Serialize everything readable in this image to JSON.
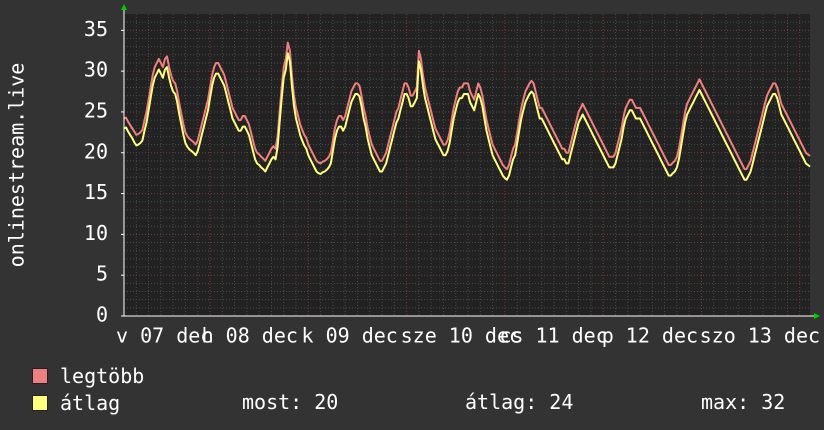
{
  "chart_data": {
    "type": "line",
    "ylabel": "onlinestream.live",
    "ylim": [
      0,
      37
    ],
    "yticks": [
      "0",
      "5",
      "10",
      "15",
      "20",
      "25",
      "30",
      "35"
    ],
    "xtick_labels": [
      "v 07 dec",
      "h 08 dec",
      "k 09 dec",
      "sze 10 dec",
      "cs 11 dec",
      "p 12 dec",
      "szo 13 dec"
    ],
    "grid": true,
    "colors": {
      "background": "#333333",
      "plot_bg": "#222222",
      "grid_major": "#7a3a3a",
      "grid_minor": "#4a4a4a",
      "max_series": "#f08080",
      "avg_series": "#ffff80",
      "axis_arrow": "#00cc00"
    },
    "x": [
      0,
      0.5,
      1,
      1.5,
      2,
      2.5,
      3,
      3.5,
      4,
      4.5,
      5,
      5.5,
      6,
      6.5,
      7,
      7.5,
      8,
      8.5,
      9,
      9.5,
      10,
      10.5,
      11,
      11.5,
      12,
      12.5,
      13,
      13.5,
      14,
      14.5,
      15,
      15.5,
      16,
      16.5,
      17,
      17.5,
      18,
      18.5,
      19,
      19.5,
      20,
      20.5,
      21,
      21.5,
      22,
      22.5,
      23,
      23.5,
      24,
      24.5,
      25,
      25.5,
      26,
      26.5,
      27,
      27.5,
      28,
      28.5,
      29,
      29.5,
      30,
      30.5,
      31,
      31.5,
      32,
      32.5,
      33,
      33.5,
      34,
      34.5,
      35,
      35.5,
      36,
      36.5,
      37,
      37.5,
      38,
      38.5,
      39,
      39.5,
      40,
      40.5,
      41,
      41.5,
      42,
      42.5,
      43,
      43.5,
      44,
      44.5,
      45,
      45.5,
      46,
      46.5,
      47,
      47.5,
      48,
      48.5,
      49,
      49.5,
      50,
      50.5,
      51,
      51.5,
      52,
      52.5,
      53,
      53.5,
      54,
      54.5,
      55,
      55.5,
      56,
      56.5,
      57,
      57.5,
      58,
      58.5,
      59,
      59.5,
      60,
      60.5,
      61,
      61.5,
      62,
      62.5,
      63,
      63.5,
      64,
      64.5,
      65,
      65.5,
      66,
      66.5,
      67,
      67.5,
      68,
      68.5,
      69,
      69.5,
      70,
      70.5,
      71,
      71.5,
      72,
      72.5,
      73,
      73.5,
      74,
      74.5,
      75,
      75.5,
      76,
      76.5,
      77,
      77.5,
      78,
      78.5,
      79,
      79.5,
      80,
      80.5,
      81,
      81.5,
      82,
      82.5,
      83,
      83.5,
      84,
      84.5,
      85,
      85.5,
      86,
      86.5,
      87,
      87.5,
      88,
      88.5,
      89,
      89.5,
      90,
      90.5,
      91,
      91.5,
      92,
      92.5,
      93,
      93.5,
      94,
      94.5,
      95,
      95.5,
      96,
      96.5,
      97,
      97.5,
      98,
      98.5,
      99,
      99.5,
      100,
      100.5,
      101,
      101.5,
      102,
      102.5,
      103,
      103.5,
      104,
      104.5,
      105,
      105.5,
      106,
      106.5,
      107,
      107.5,
      108,
      108.5,
      109,
      109.5,
      110,
      110.5,
      111,
      111.5,
      112,
      112.5,
      113,
      113.5,
      114,
      114.5,
      115,
      115.5,
      116,
      116.5,
      117,
      117.5,
      118,
      118.5,
      119,
      119.5,
      120,
      120.5,
      121,
      121.5,
      122,
      122.5,
      123,
      123.5,
      124,
      124.5,
      125,
      125.5,
      126,
      126.5,
      127,
      127.5,
      128,
      128.5,
      129,
      129.5,
      130,
      130.5,
      131,
      131.5,
      132,
      132.5,
      133,
      133.5,
      134,
      134.5,
      135,
      135.5,
      136,
      136.5,
      137,
      137.5,
      138,
      138.5,
      139,
      139.5,
      140,
      140.5,
      141,
      141.5,
      142,
      142.5,
      143,
      143.5,
      144,
      144.5,
      145,
      145.5,
      146,
      146.5,
      147,
      147.5,
      148,
      148.5,
      149,
      149.5,
      150,
      150.5,
      151,
      151.5,
      152,
      152.5,
      153,
      153.5,
      154,
      154.5,
      155,
      155.5,
      156,
      156.5,
      157,
      157.5,
      158,
      158.5,
      159,
      159.5,
      160,
      160.5,
      161,
      161.5,
      162,
      162.5,
      163,
      163.5,
      164,
      164.5,
      165,
      165.5,
      166,
      166.5,
      167,
      167.5
    ],
    "series": [
      {
        "name": "legtöbb",
        "values": [
          24.2,
          24.3,
          23.8,
          23.4,
          23.0,
          22.6,
          22.2,
          22.3,
          22.5,
          22.8,
          24.0,
          25.0,
          26.5,
          28.0,
          29.5,
          30.5,
          31.0,
          31.5,
          31.0,
          30.5,
          31.5,
          31.8,
          30.5,
          29.5,
          28.8,
          28.5,
          27.5,
          26.0,
          24.8,
          23.5,
          22.5,
          22.0,
          21.7,
          21.5,
          21.3,
          21.0,
          21.5,
          22.5,
          23.5,
          24.5,
          25.5,
          26.5,
          28.0,
          29.5,
          30.5,
          31.0,
          31.0,
          30.5,
          30.0,
          29.5,
          28.5,
          27.5,
          26.5,
          25.5,
          25.0,
          24.5,
          24.0,
          24.0,
          24.5,
          24.5,
          24.0,
          23.5,
          22.5,
          21.5,
          20.5,
          20.0,
          19.8,
          19.5,
          19.3,
          19.0,
          19.5,
          20.0,
          20.5,
          20.8,
          20.5,
          22.0,
          25.0,
          28.0,
          30.5,
          31.5,
          33.5,
          32.5,
          29.5,
          27.0,
          25.5,
          24.5,
          23.5,
          22.8,
          22.2,
          21.8,
          21.0,
          20.5,
          20.0,
          19.5,
          19.0,
          18.8,
          18.7,
          18.9,
          19.0,
          19.2,
          19.5,
          20.0,
          21.5,
          23.0,
          24.0,
          24.5,
          24.5,
          24.0,
          24.5,
          25.5,
          26.5,
          27.5,
          28.0,
          28.5,
          28.5,
          28.2,
          27.0,
          25.5,
          24.5,
          23.0,
          22.0,
          21.0,
          20.5,
          20.0,
          19.5,
          19.0,
          19.0,
          19.5,
          20.0,
          21.0,
          22.0,
          23.0,
          24.0,
          25.0,
          25.5,
          26.5,
          27.5,
          28.5,
          28.5,
          28.0,
          27.0,
          27.0,
          27.5,
          28.0,
          32.5,
          31.5,
          29.5,
          28.0,
          27.0,
          26.0,
          25.0,
          24.0,
          23.0,
          22.5,
          22.0,
          21.5,
          21.0,
          21.0,
          21.5,
          22.5,
          24.0,
          25.5,
          26.5,
          27.5,
          28.0,
          28.0,
          28.5,
          28.5,
          28.5,
          27.5,
          27.0,
          26.5,
          27.5,
          28.5,
          28.0,
          27.0,
          25.5,
          24.0,
          23.0,
          22.0,
          21.0,
          20.5,
          20.0,
          19.5,
          19.0,
          18.5,
          18.2,
          18.0,
          18.5,
          19.5,
          20.5,
          21.0,
          22.5,
          24.0,
          25.5,
          26.5,
          27.5,
          28.0,
          28.5,
          28.8,
          28.5,
          27.5,
          26.5,
          25.5,
          25.5,
          25.0,
          24.5,
          24.0,
          23.5,
          23.0,
          22.5,
          22.0,
          21.5,
          21.0,
          20.5,
          20.5,
          20.0,
          20.0,
          21.0,
          22.0,
          23.0,
          24.0,
          25.0,
          25.5,
          26.0,
          25.5,
          25.0,
          24.5,
          24.0,
          23.5,
          23.0,
          22.5,
          22.0,
          21.5,
          21.0,
          20.5,
          20.0,
          19.5,
          19.5,
          19.5,
          20.0,
          21.0,
          22.0,
          23.0,
          24.5,
          25.5,
          26.0,
          26.5,
          26.5,
          26.0,
          25.5,
          25.5,
          25.5,
          25.0,
          24.5,
          24.0,
          23.5,
          23.0,
          22.5,
          22.0,
          21.5,
          21.0,
          20.5,
          20.0,
          19.5,
          19.0,
          18.5,
          18.5,
          18.8,
          19.0,
          19.5,
          20.5,
          22.0,
          23.5,
          25.0,
          26.0,
          26.5,
          27.0,
          27.5,
          28.0,
          28.5,
          29.0,
          28.5,
          28.0,
          27.5,
          27.0,
          26.5,
          26.0,
          25.5,
          25.0,
          24.5,
          24.0,
          23.5,
          23.0,
          22.5,
          22.0,
          21.5,
          21.0,
          20.5,
          20.0,
          19.5,
          19.0,
          18.5,
          18.0,
          18.0,
          18.5,
          19.0,
          20.0,
          21.0,
          22.0,
          23.0,
          24.0,
          25.0,
          26.0,
          27.0,
          27.5,
          28.0,
          28.5,
          28.5,
          28.0,
          27.0,
          26.0,
          25.5,
          25.0,
          24.5,
          24.0,
          23.5,
          23.0,
          22.5,
          22.0,
          21.5,
          21.0,
          20.5,
          20.0,
          19.8,
          19.6
        ]
      },
      {
        "name": "átlag",
        "values": [
          23.0,
          23.1,
          22.6,
          22.2,
          21.8,
          21.3,
          20.9,
          21.0,
          21.2,
          21.5,
          22.7,
          23.7,
          25.2,
          26.7,
          28.2,
          29.2,
          29.7,
          30.2,
          29.7,
          29.2,
          30.2,
          30.5,
          29.2,
          28.2,
          27.5,
          27.2,
          26.2,
          24.7,
          23.5,
          22.2,
          21.2,
          20.7,
          20.4,
          20.2,
          20.0,
          19.7,
          20.2,
          21.2,
          22.2,
          23.2,
          24.2,
          25.2,
          26.7,
          28.2,
          29.2,
          29.7,
          29.7,
          29.2,
          28.7,
          28.2,
          27.2,
          26.2,
          25.2,
          24.2,
          23.7,
          23.2,
          22.7,
          22.7,
          23.2,
          23.2,
          22.7,
          22.2,
          21.2,
          20.2,
          19.2,
          18.7,
          18.5,
          18.2,
          18.0,
          17.7,
          18.2,
          18.7,
          19.2,
          19.5,
          19.2,
          20.7,
          23.7,
          26.7,
          29.2,
          30.2,
          32.2,
          31.2,
          28.2,
          25.7,
          24.2,
          23.2,
          22.2,
          21.5,
          20.9,
          20.5,
          19.7,
          19.2,
          18.7,
          18.2,
          17.7,
          17.5,
          17.4,
          17.6,
          17.7,
          17.9,
          18.2,
          18.7,
          20.2,
          21.7,
          22.7,
          23.2,
          23.2,
          22.7,
          23.2,
          24.2,
          25.2,
          26.2,
          26.7,
          27.2,
          27.2,
          26.9,
          25.7,
          24.2,
          23.2,
          21.7,
          20.7,
          19.7,
          19.2,
          18.7,
          18.2,
          17.7,
          17.7,
          18.2,
          18.7,
          19.7,
          20.7,
          21.7,
          22.7,
          23.7,
          24.2,
          25.2,
          26.2,
          27.2,
          27.2,
          26.7,
          25.7,
          25.7,
          26.2,
          26.7,
          31.2,
          30.2,
          28.2,
          26.7,
          25.7,
          24.7,
          23.7,
          22.7,
          21.7,
          21.2,
          20.7,
          20.2,
          19.7,
          19.7,
          20.2,
          21.2,
          22.7,
          24.2,
          25.2,
          26.2,
          26.7,
          26.7,
          27.2,
          27.2,
          27.2,
          26.2,
          25.7,
          25.2,
          26.2,
          27.2,
          26.7,
          25.7,
          24.2,
          22.7,
          21.7,
          20.7,
          19.7,
          19.2,
          18.7,
          18.2,
          17.7,
          17.2,
          16.9,
          16.7,
          17.2,
          18.2,
          19.2,
          19.7,
          21.2,
          22.7,
          24.2,
          25.2,
          26.2,
          26.7,
          27.2,
          27.5,
          27.2,
          26.2,
          25.2,
          24.2,
          24.2,
          23.7,
          23.2,
          22.7,
          22.2,
          21.7,
          21.2,
          20.7,
          20.2,
          19.7,
          19.2,
          19.2,
          18.7,
          18.7,
          19.7,
          20.7,
          21.7,
          22.7,
          23.7,
          24.2,
          24.7,
          24.2,
          23.7,
          23.2,
          22.7,
          22.2,
          21.7,
          21.2,
          20.7,
          20.2,
          19.7,
          19.2,
          18.7,
          18.2,
          18.2,
          18.2,
          18.7,
          19.7,
          20.7,
          21.7,
          23.2,
          24.2,
          24.7,
          25.2,
          25.2,
          24.7,
          24.2,
          24.2,
          24.2,
          23.7,
          23.2,
          22.7,
          22.2,
          21.7,
          21.2,
          20.7,
          20.2,
          19.7,
          19.2,
          18.7,
          18.2,
          17.7,
          17.2,
          17.2,
          17.5,
          17.7,
          18.2,
          19.2,
          20.7,
          22.2,
          23.7,
          24.7,
          25.2,
          25.7,
          26.2,
          26.7,
          27.2,
          27.7,
          27.2,
          26.7,
          26.2,
          25.7,
          25.2,
          24.7,
          24.2,
          23.7,
          23.2,
          22.7,
          22.2,
          21.7,
          21.2,
          20.7,
          20.2,
          19.7,
          19.2,
          18.7,
          18.2,
          17.7,
          17.2,
          16.7,
          16.7,
          17.2,
          17.7,
          18.7,
          19.7,
          20.7,
          21.7,
          22.7,
          23.7,
          24.7,
          25.7,
          26.2,
          26.7,
          27.2,
          27.2,
          26.7,
          25.7,
          24.7,
          24.2,
          23.7,
          23.2,
          22.7,
          22.2,
          21.7,
          21.2,
          20.7,
          20.2,
          19.7,
          19.2,
          18.7,
          18.5,
          18.3
        ]
      }
    ]
  },
  "legend": [
    {
      "label": "legtöbb",
      "color": "#f08080"
    },
    {
      "label": "átlag",
      "color": "#ffff80"
    }
  ],
  "stats": {
    "most_label": "most:",
    "most_value": "20",
    "atlag_label": "átlag:",
    "atlag_value": "24",
    "max_label": "max:",
    "max_value": "32"
  }
}
